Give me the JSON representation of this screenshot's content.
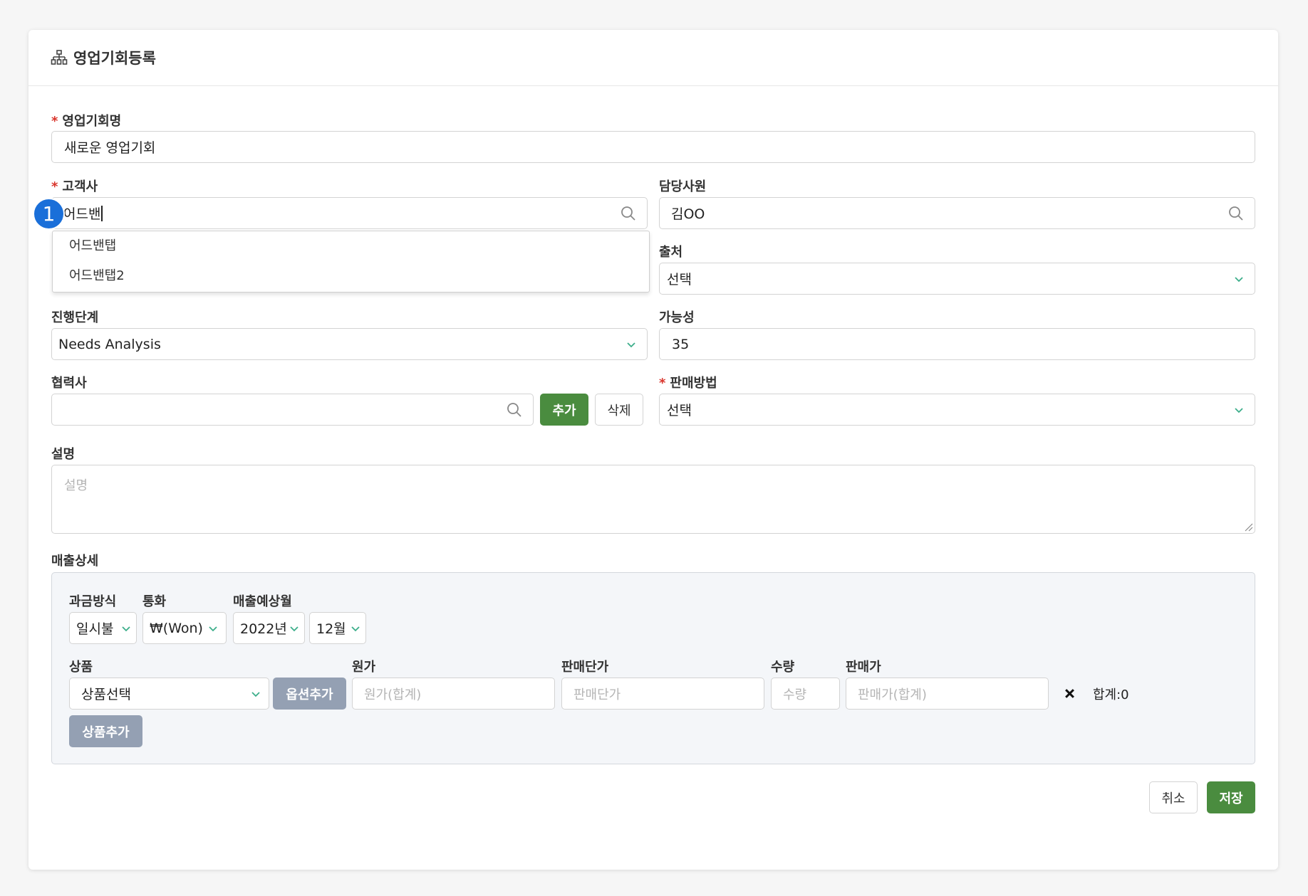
{
  "header": {
    "title": "영업기회등록",
    "icon": "org-chart-icon"
  },
  "required_mark": "*",
  "opportunity_name": {
    "label": "영업기회명",
    "value": "새로운 영업기회"
  },
  "customer": {
    "label": "고객사",
    "value": "어드밴",
    "suggestions": [
      "어드밴탭",
      "어드밴탭2"
    ]
  },
  "step_badge": "1",
  "manager": {
    "label": "담당사원",
    "value": "김OO"
  },
  "source": {
    "label": "출처",
    "value": "선택"
  },
  "stage": {
    "label": "진행단계",
    "value": "Needs Analysis"
  },
  "probability": {
    "label": "가능성",
    "value": "35"
  },
  "partner": {
    "label": "협력사",
    "value": "",
    "add_label": "추가",
    "delete_label": "삭제"
  },
  "sales_method": {
    "label": "판매방법",
    "value": "선택"
  },
  "description": {
    "label": "설명",
    "placeholder": "설명"
  },
  "sales_detail": {
    "label": "매출상세",
    "billing": {
      "label": "과금방식",
      "value": "일시불"
    },
    "currency": {
      "label": "통화",
      "value": "₩(Won)"
    },
    "expected_month": {
      "label": "매출예상월",
      "year": "2022년",
      "month": "12월"
    },
    "product": {
      "label": "상품",
      "value": "상품선택",
      "option_add_label": "옵션추가"
    },
    "cost": {
      "label": "원가",
      "placeholder": "원가(합계)"
    },
    "unit_price": {
      "label": "판매단가",
      "placeholder": "판매단가"
    },
    "quantity": {
      "label": "수량",
      "placeholder": "수량"
    },
    "price": {
      "label": "판매가",
      "placeholder": "판매가(합계)"
    },
    "remove_icon": "close-icon",
    "total_text": "합계:0",
    "add_product_label": "상품추가"
  },
  "footer": {
    "cancel_label": "취소",
    "save_label": "저장"
  },
  "colors": {
    "primary_green": "#4a8c3f",
    "badge_blue": "#1a6fd9",
    "required_red": "#d9342b",
    "chevron_green": "#3cae8a",
    "disabled_gray": "#94a0b3"
  }
}
